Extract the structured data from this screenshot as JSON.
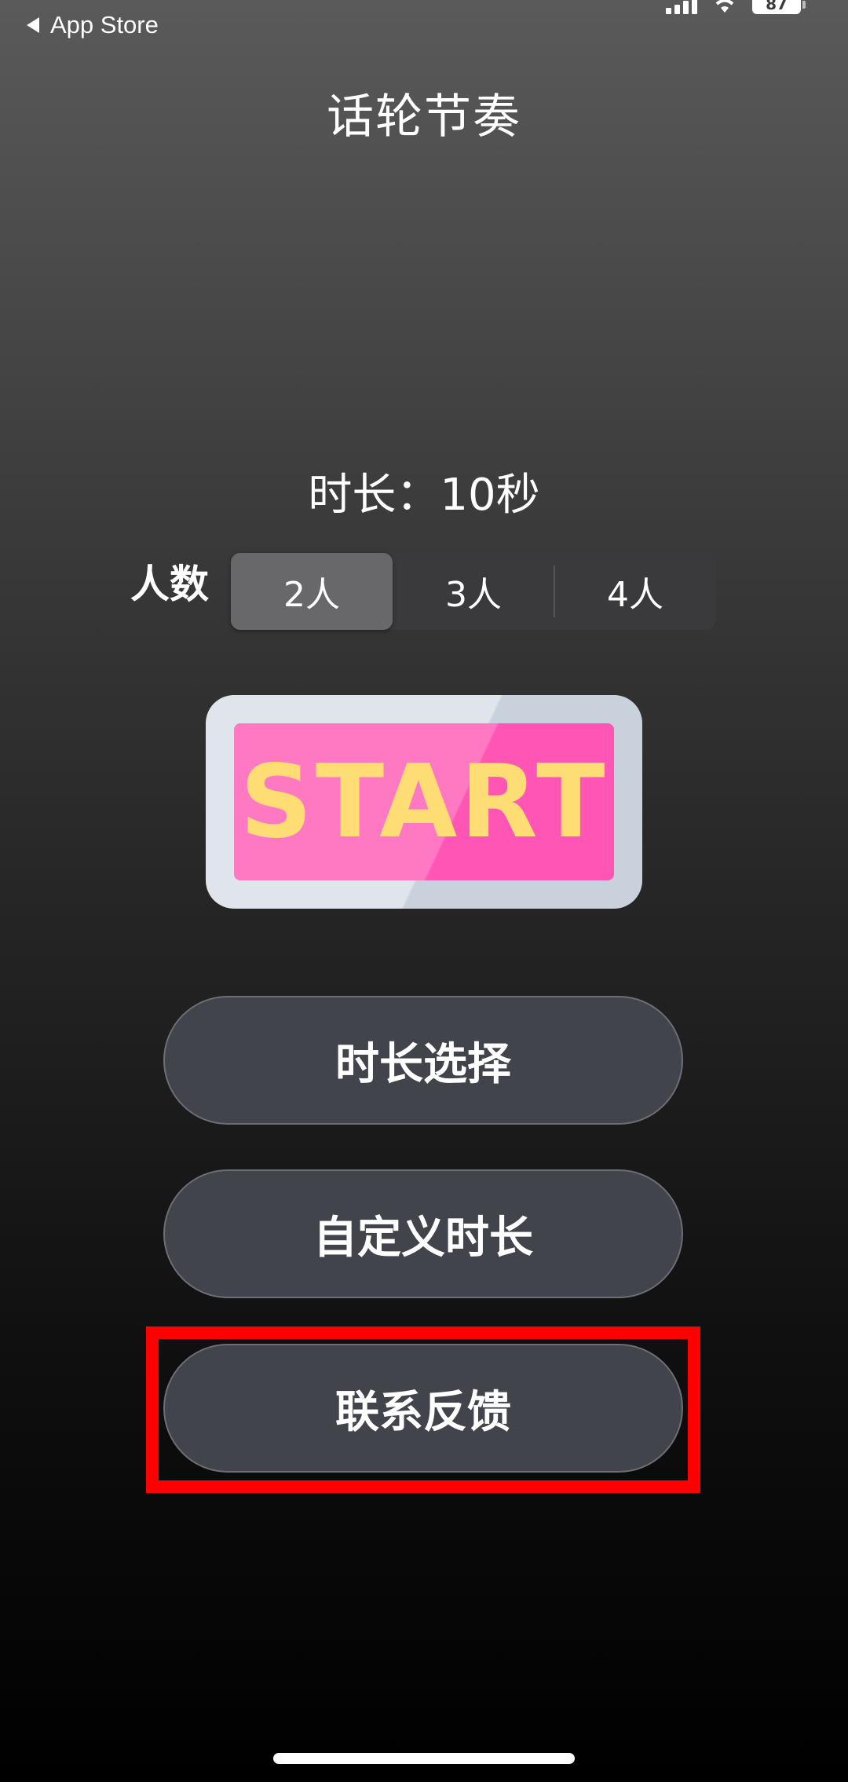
{
  "status_bar": {
    "back_label": "App Store",
    "battery": "87"
  },
  "title": "话轮节奏",
  "duration": {
    "text": "时长：10秒"
  },
  "people": {
    "label": "人数",
    "options": [
      "2人",
      "3人",
      "4人"
    ],
    "selected": "2人"
  },
  "start_button": {
    "label": "START"
  },
  "menu": {
    "duration_select": "时长选择",
    "custom_duration": "自定义时长",
    "contact_feedback": "联系反馈"
  },
  "colors": {
    "highlight": "#ff0000",
    "start_pink": "#ff79c2",
    "start_text": "#ffdd75",
    "pill_bg": "#41454b"
  }
}
